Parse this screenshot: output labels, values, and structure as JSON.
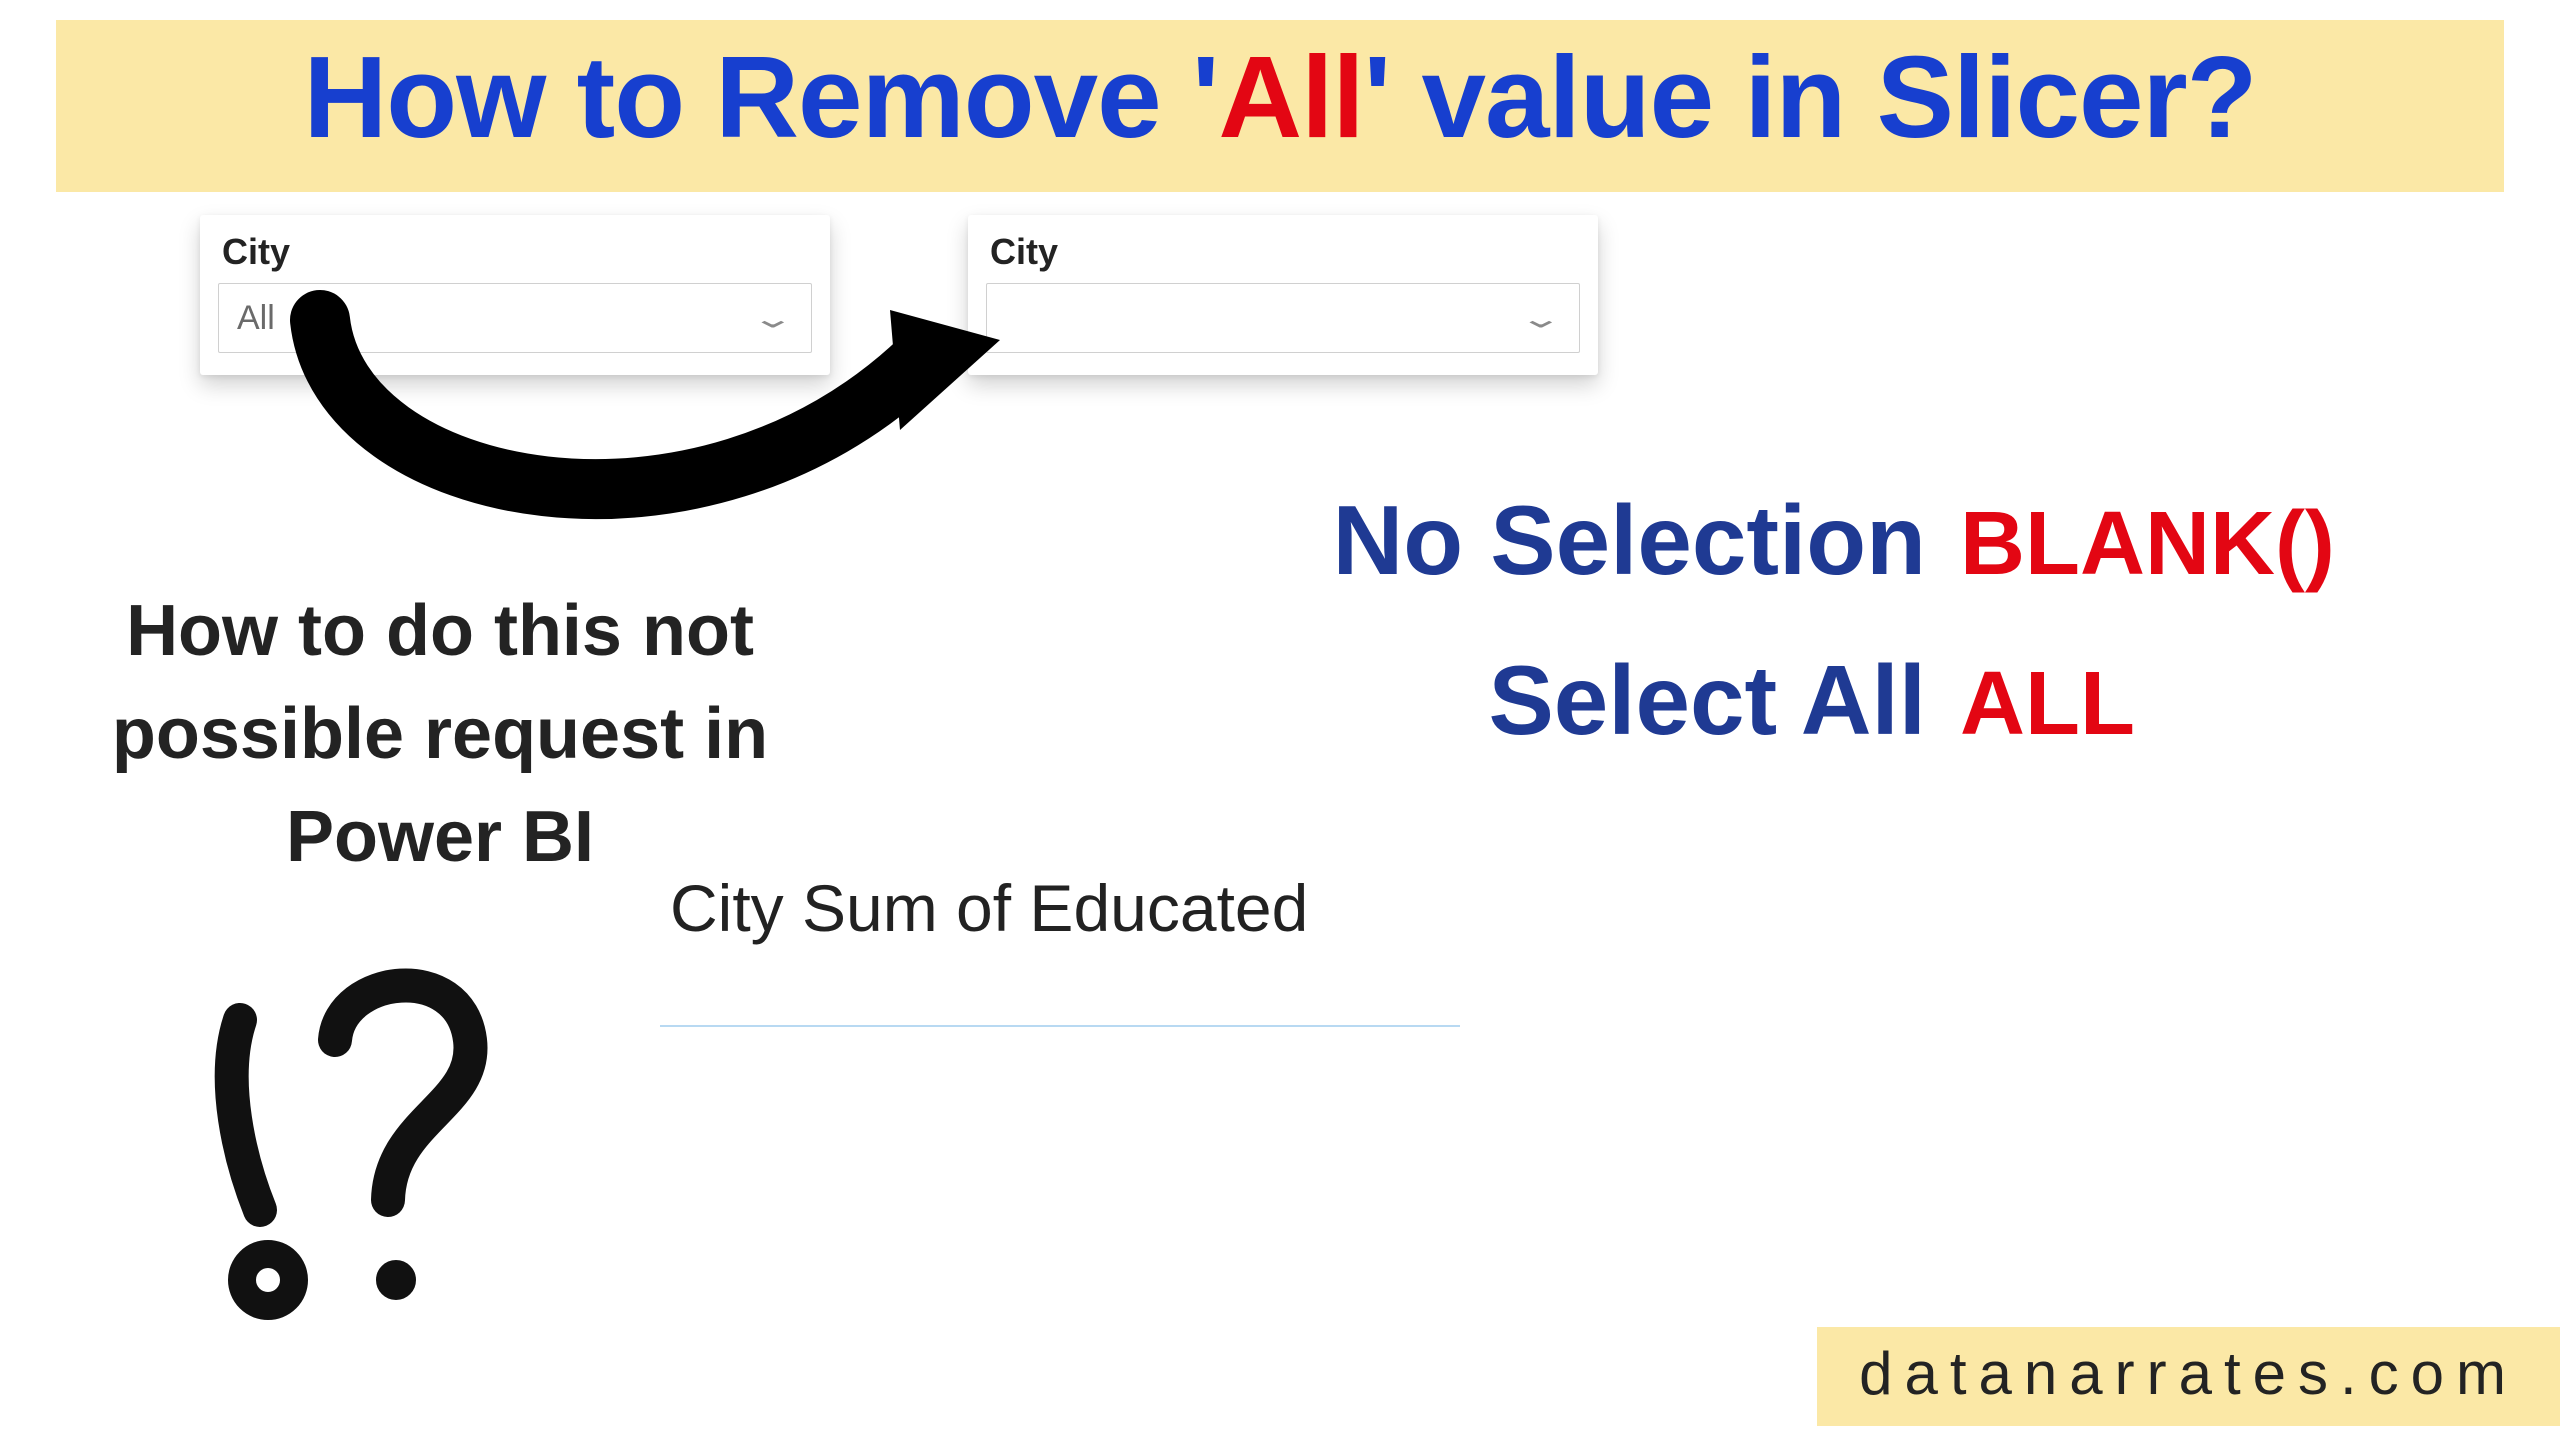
{
  "title": {
    "part1": "How to Remove '",
    "highlight": "All",
    "part2": "' value in Slicer?"
  },
  "slicer": {
    "label": "City",
    "beforeValue": "All",
    "afterValue": ""
  },
  "subtext": "How to do this not possible request in Power BI",
  "tableHeader": "City Sum of Educated",
  "mapping": {
    "row1": {
      "left": "No Selection",
      "right": "BLANK()"
    },
    "row2": {
      "left": "Select All",
      "right": "ALL"
    }
  },
  "footer": "datanarrates.com"
}
